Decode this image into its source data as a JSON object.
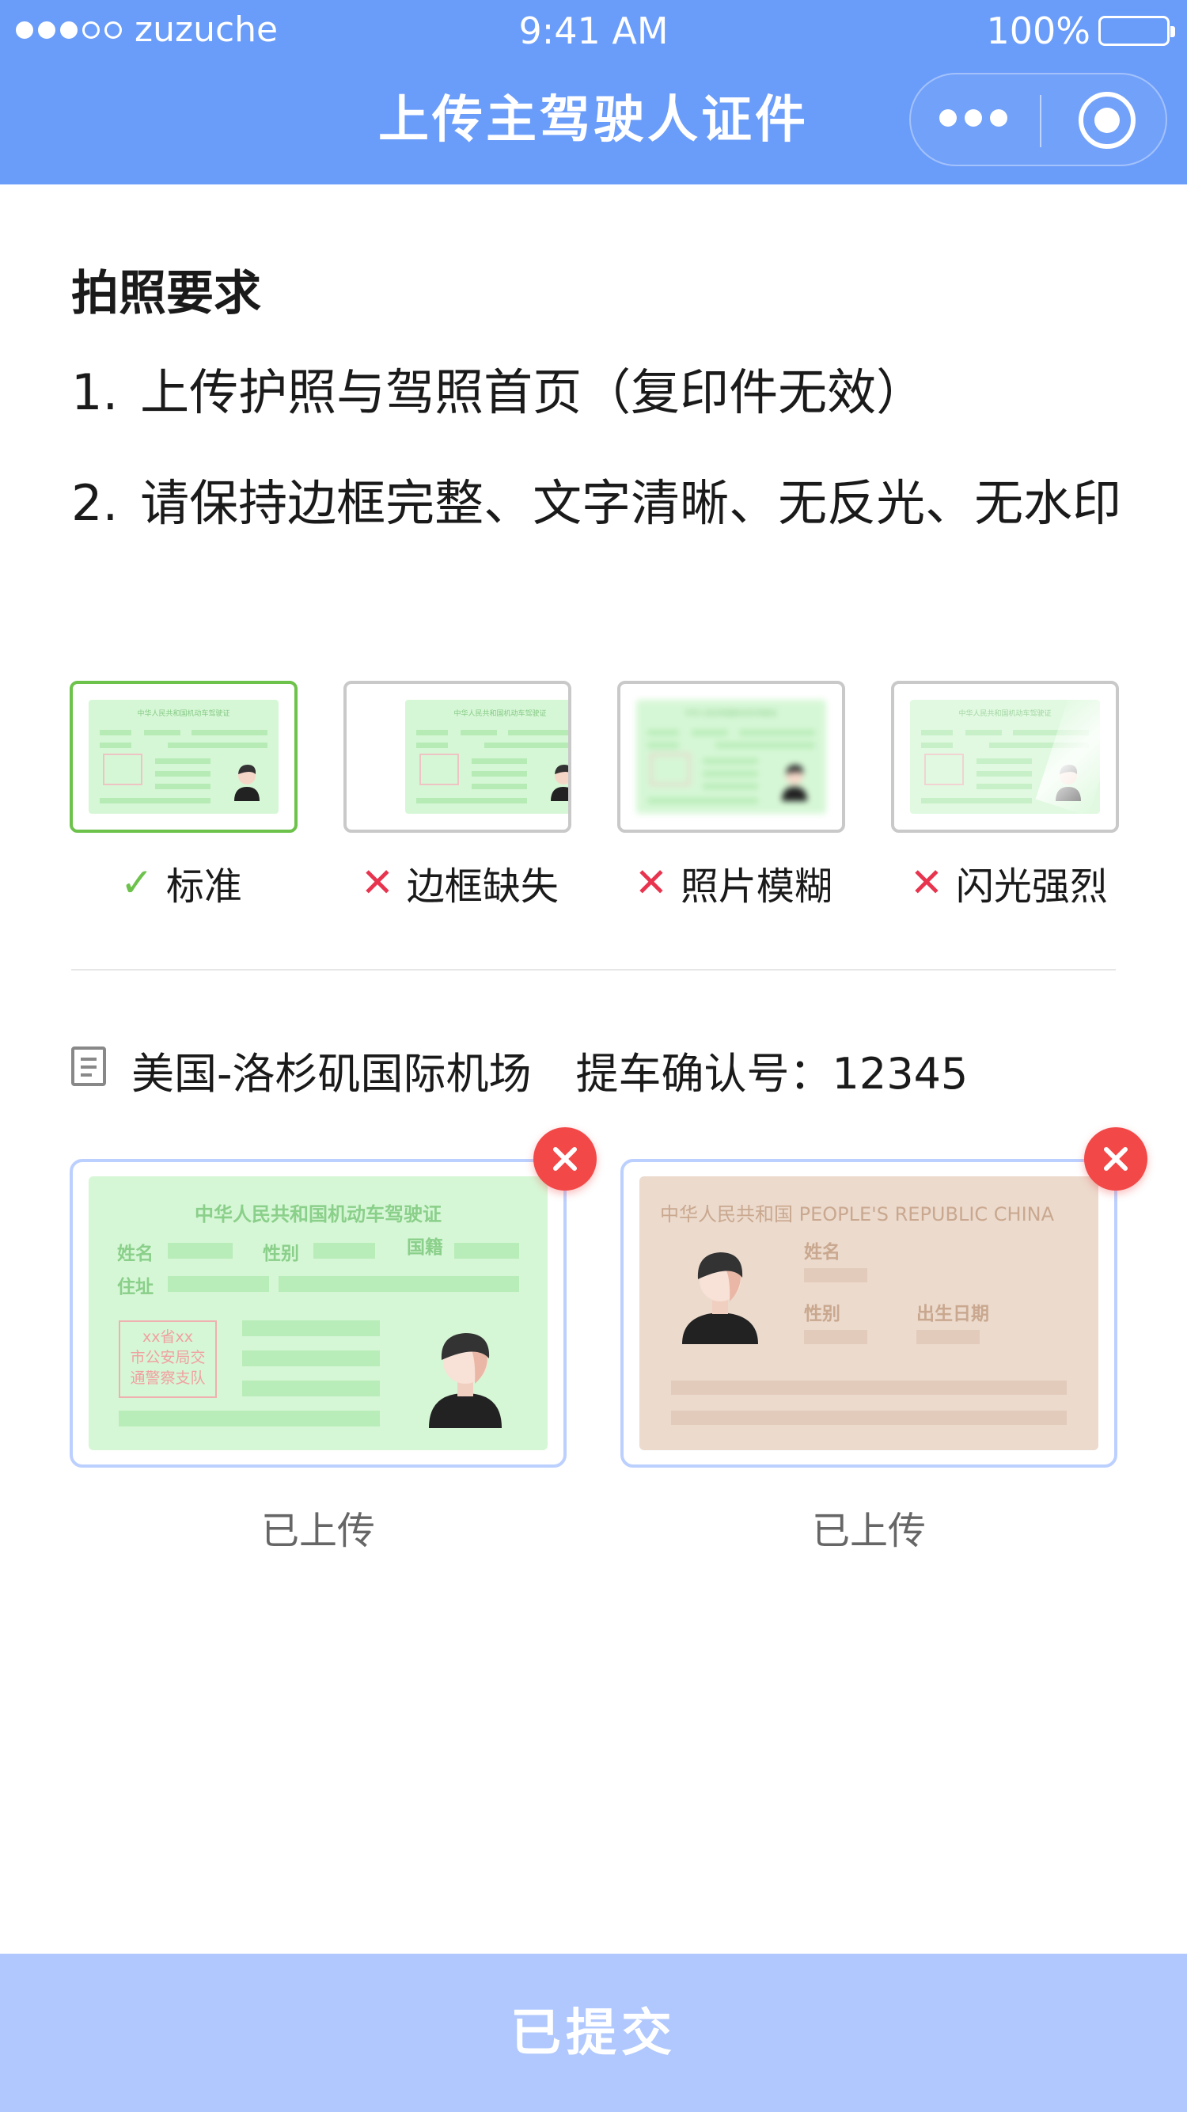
{
  "status": {
    "carrier": "zuzuche",
    "time": "9:41 AM",
    "battery": "100%"
  },
  "nav": {
    "title": "上传主驾驶人证件"
  },
  "requirements": {
    "title": "拍照要求",
    "items": [
      {
        "num": "1.",
        "text": "上传护照与驾照首页（复印件无效）"
      },
      {
        "num": "2.",
        "text": "请保持边框完整、文字清晰、无反光、无水印"
      }
    ]
  },
  "examples": [
    {
      "label": "标准",
      "status": "ok"
    },
    {
      "label": "边框缺失",
      "status": "bad"
    },
    {
      "label": "照片模糊",
      "status": "bad"
    },
    {
      "label": "闪光强烈",
      "status": "bad"
    }
  ],
  "mini_card": {
    "title": "中华人民共和国机动车驾驶证"
  },
  "order": {
    "location": "美国-洛杉矶国际机场",
    "confirm": "提车确认号：12345"
  },
  "license_card": {
    "title": "中华人民共和国机动车驾驶证",
    "name": "姓名",
    "gender": "性别",
    "nationality": "国籍",
    "address": "住址",
    "stamp": [
      "xx省xx",
      "市公安局交",
      "通警察支队"
    ]
  },
  "passport_card": {
    "title": "中华人民共和国 PEOPLE'S REPUBLIC CHINA",
    "name": "姓名",
    "gender": "性别",
    "birth": "出生日期"
  },
  "uploads": [
    {
      "label": "已上传"
    },
    {
      "label": "已上传"
    }
  ],
  "submit": {
    "label": "已提交"
  },
  "colors": {
    "header": "#6a9cfa",
    "submit": "#b0c8fd",
    "ok": "#6cc24a",
    "bad": "#e8344e",
    "delete": "#f24848"
  }
}
